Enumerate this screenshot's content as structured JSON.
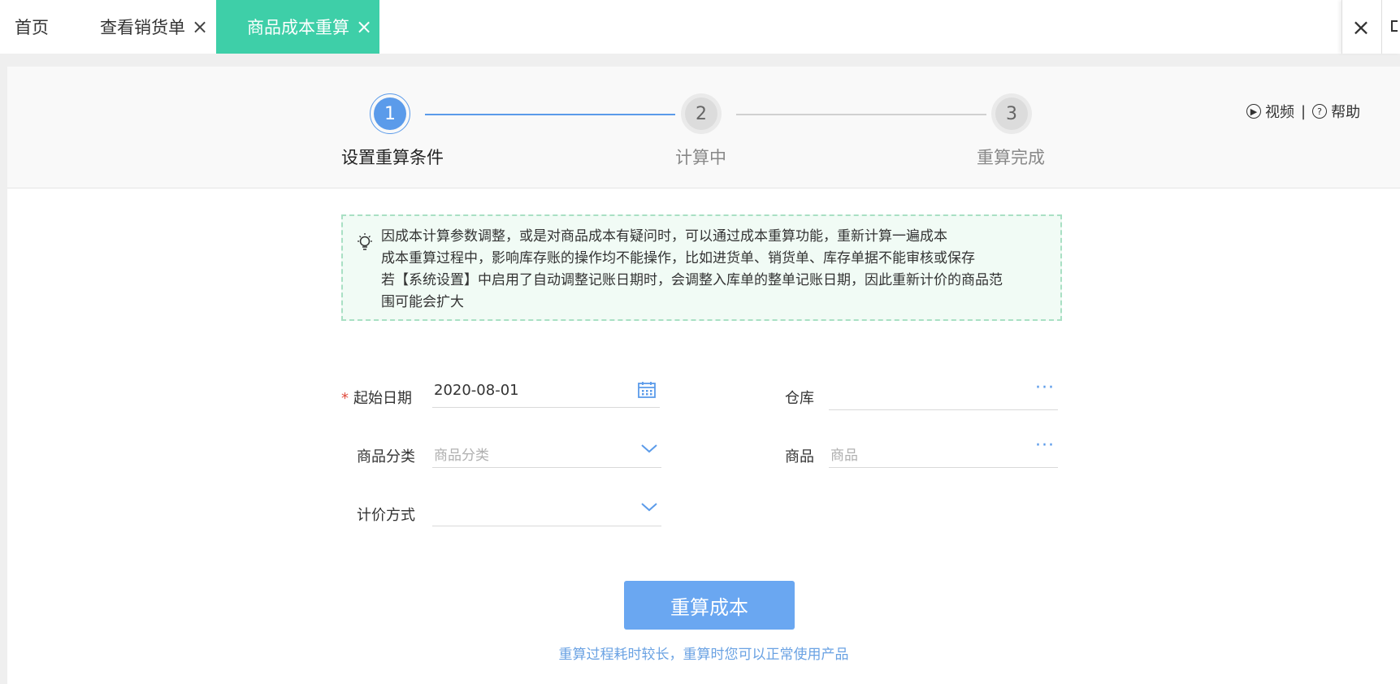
{
  "tabs": [
    {
      "label": "首页"
    },
    {
      "label": "查看销货单",
      "close": "×"
    },
    {
      "label": "商品成本重算",
      "close": "×",
      "active": true
    }
  ],
  "toolbar": {
    "close_all": "×"
  },
  "steps": [
    {
      "number": "1",
      "label": "设置重算条件",
      "state": "active"
    },
    {
      "number": "2",
      "label": "计算中",
      "state": "pending"
    },
    {
      "number": "3",
      "label": "重算完成",
      "state": "pending"
    }
  ],
  "help": {
    "video": "视频",
    "separator": "|",
    "help": "帮助"
  },
  "notice": {
    "lines": [
      "因成本计算参数调整，或是对商品成本有疑问时，可以通过成本重算功能，重新计算一遍成本",
      "成本重算过程中，影响库存账的操作均不能操作，比如进货单、销货单、库存单据不能审核或保存",
      "若【系统设置】中启用了自动调整记账日期时，会调整入库单的整单记账日期，因此重新计价的商品范",
      "围可能会扩大"
    ]
  },
  "form": {
    "start_date": {
      "required_mark": "*",
      "label": "起始日期",
      "value": "2020-08-01"
    },
    "warehouse": {
      "label": "仓库",
      "value": ""
    },
    "category": {
      "label": "商品分类",
      "placeholder": "商品分类"
    },
    "product": {
      "label": "商品",
      "placeholder": "商品"
    },
    "pricing": {
      "label": "计价方式",
      "value": ""
    }
  },
  "actions": {
    "recalc": "重算成本",
    "hint": "重算过程耗时较长，重算时您可以正常使用产品"
  },
  "colors": {
    "tab_active": "#3ecfa8",
    "primary": "#5b9bea",
    "button": "#6aa7f1",
    "notice_bg": "#f1fbf5",
    "required": "#e04a3c"
  }
}
